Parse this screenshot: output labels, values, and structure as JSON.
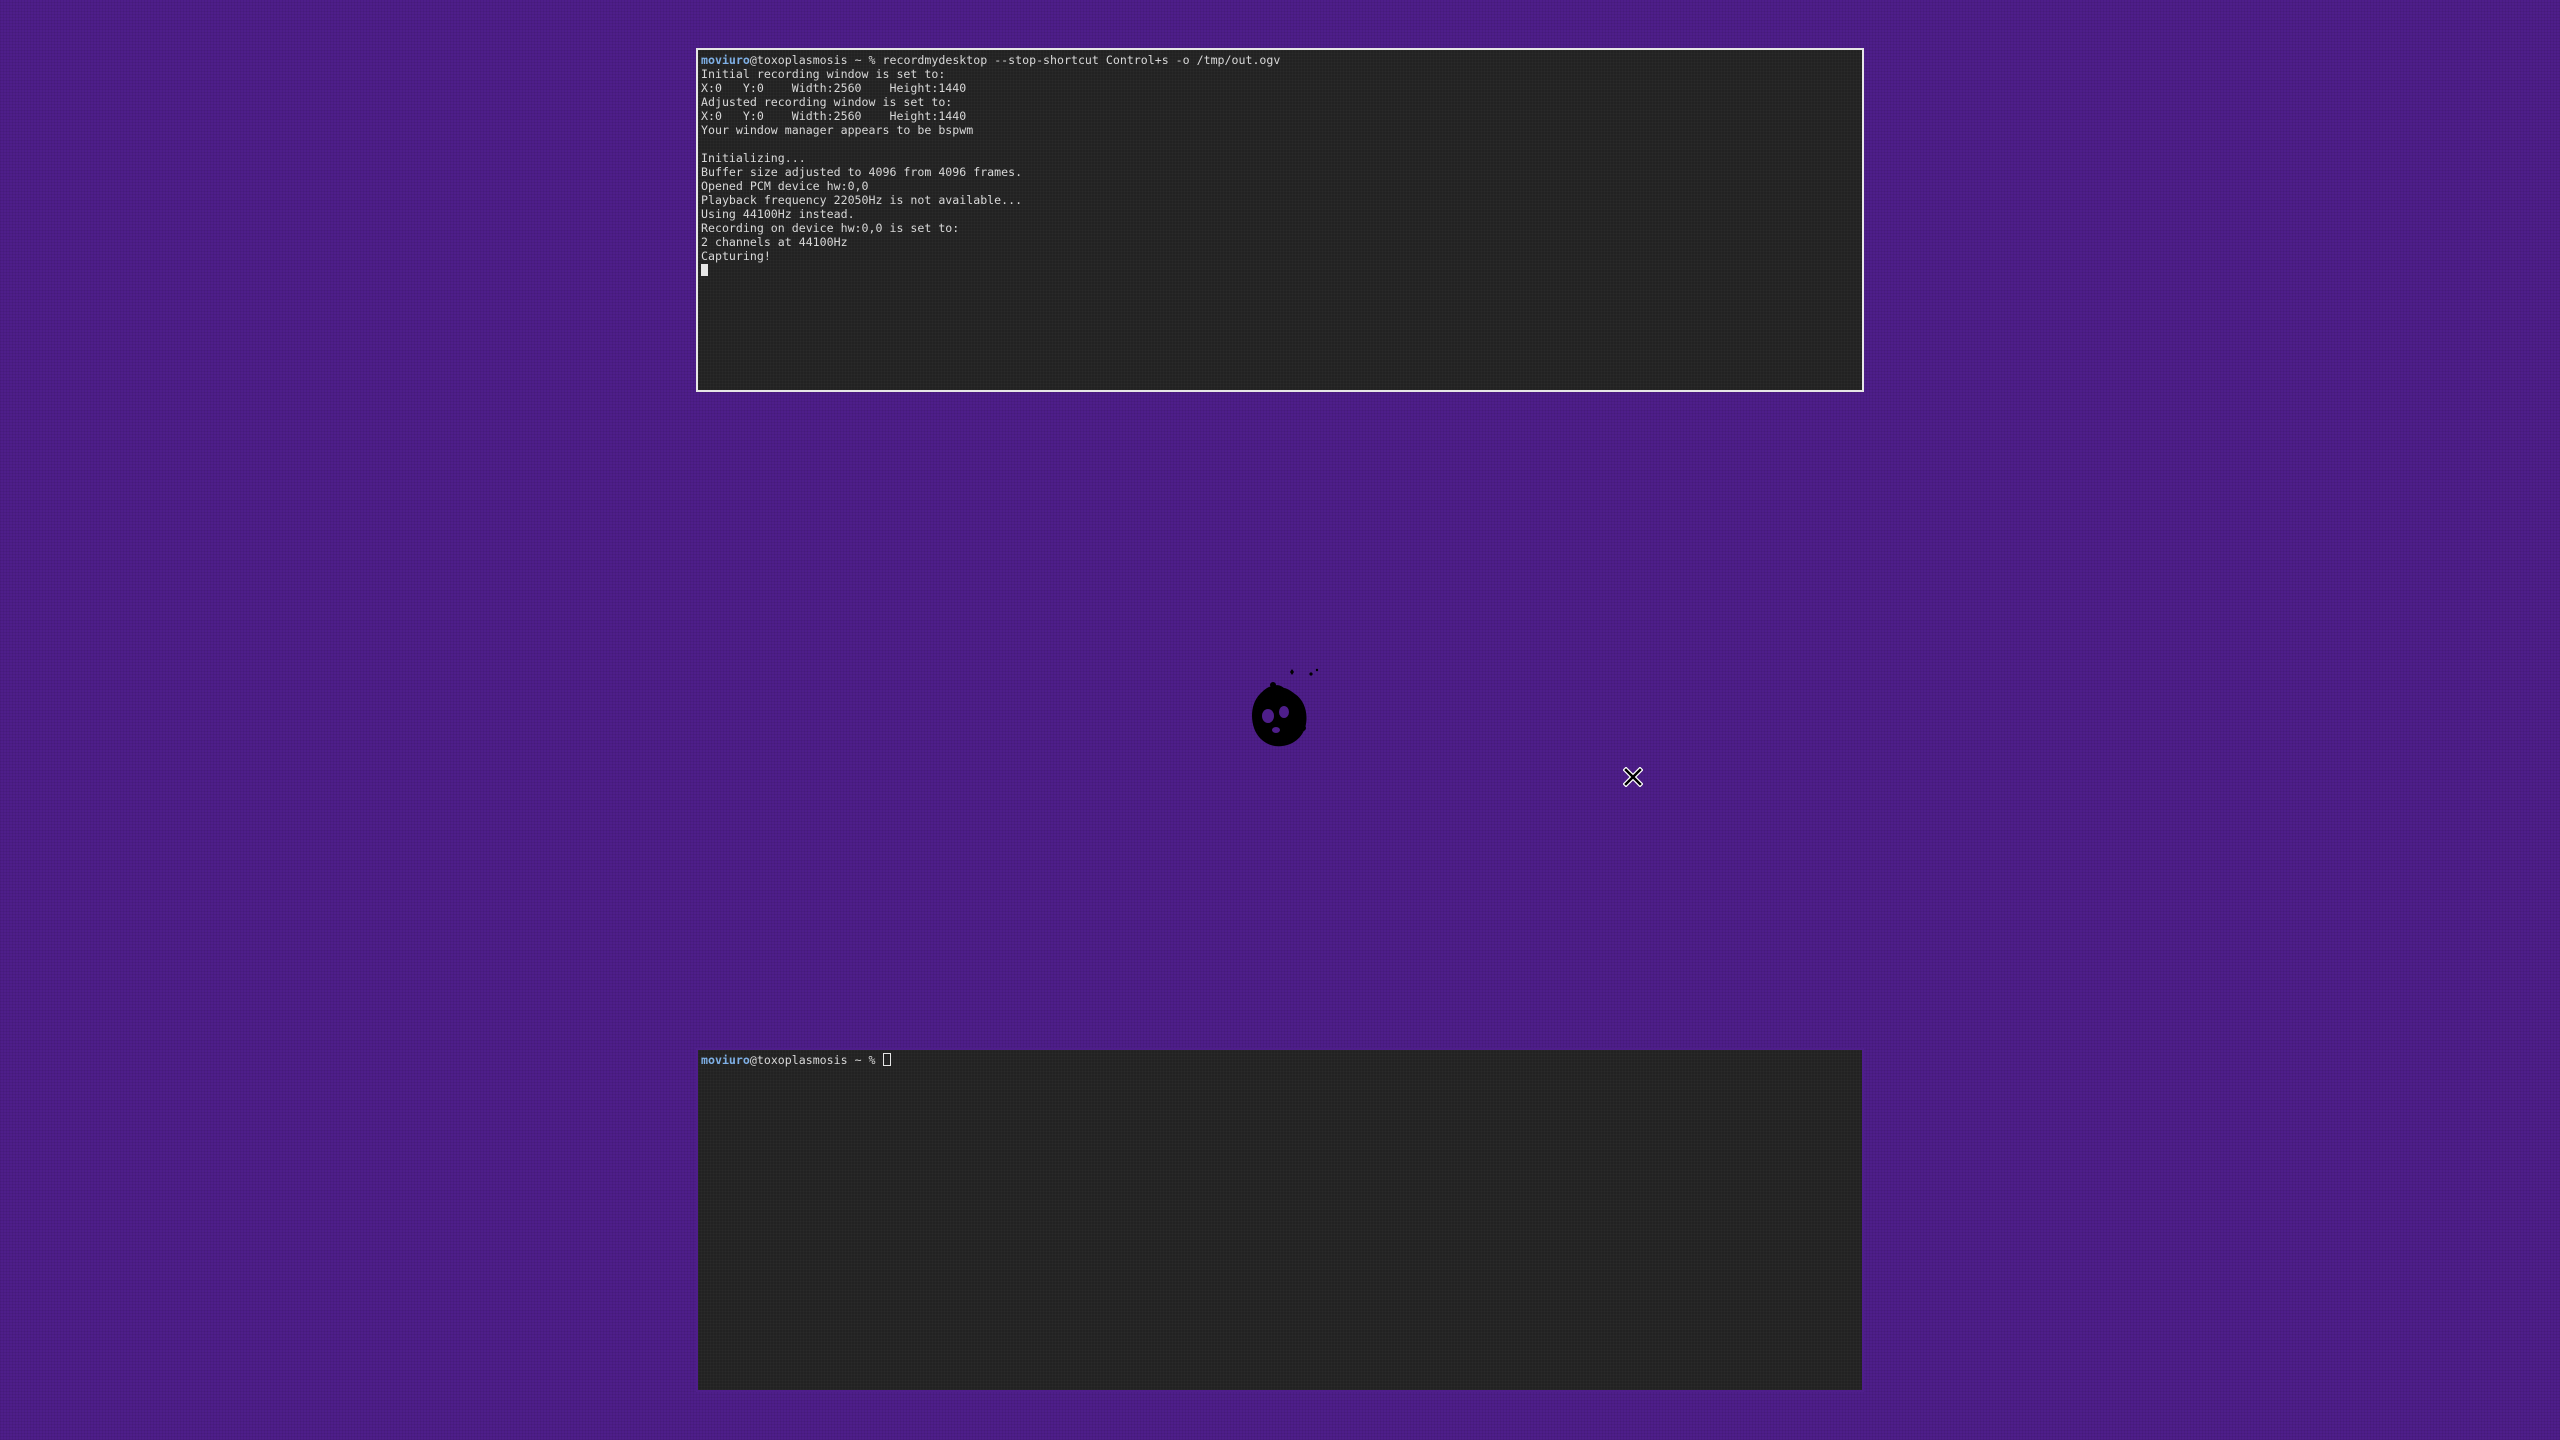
{
  "desktop": {
    "background_color": "#4e1e8a",
    "wallpaper_icon": "ghost-blob-icon",
    "pointer_icon": "x-cursor-icon"
  },
  "terminal_top": {
    "prompt": {
      "user": "moviuro",
      "host": "@toxoplasmosis",
      "rest": " ~ % ",
      "command": "recordmydesktop --stop-shortcut Control+s -o /tmp/out.ogv"
    },
    "output": [
      "Initial recording window is set to:",
      "X:0   Y:0    Width:2560    Height:1440",
      "Adjusted recording window is set to:",
      "X:0   Y:0    Width:2560    Height:1440",
      "Your window manager appears to be bspwm",
      "",
      "Initializing...",
      "Buffer size adjusted to 4096 from 4096 frames.",
      "Opened PCM device hw:0,0",
      "Playback frequency 22050Hz is not available...",
      "Using 44100Hz instead.",
      "Recording on device hw:0,0 is set to:",
      "2 channels at 44100Hz",
      "Capturing!"
    ],
    "border_color": "#e6e6e6"
  },
  "terminal_bottom": {
    "prompt": {
      "user": "moviuro",
      "host": "@toxoplasmosis",
      "rest": " ~ % "
    }
  }
}
